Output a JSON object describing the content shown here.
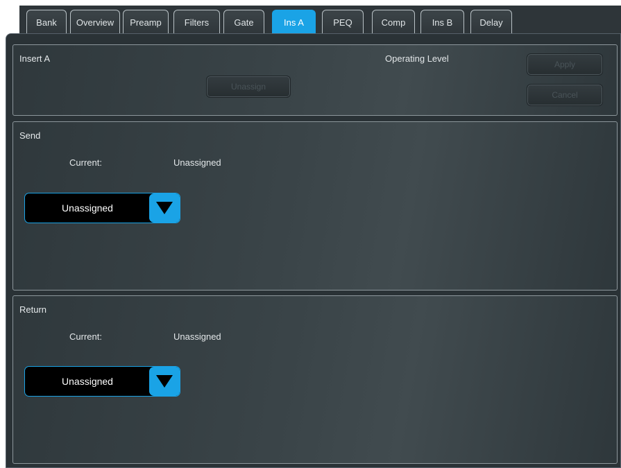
{
  "tabs": [
    {
      "label": "Bank"
    },
    {
      "label": "Overview"
    },
    {
      "label": "Preamp"
    },
    {
      "label": "Filters"
    },
    {
      "label": "Gate"
    },
    {
      "label": "Ins A"
    },
    {
      "label": "PEQ"
    },
    {
      "label": "Comp"
    },
    {
      "label": "Ins B"
    },
    {
      "label": "Delay"
    }
  ],
  "active_tab": "Ins A",
  "insert": {
    "title": "Insert A",
    "operating_level_label": "Operating Level",
    "unassign_label": "Unassign",
    "apply_label": "Apply",
    "cancel_label": "Cancel"
  },
  "send": {
    "title": "Send",
    "current_label": "Current:",
    "current_value": "Unassigned",
    "dropdown_value": "Unassigned"
  },
  "return": {
    "title": "Return",
    "current_label": "Current:",
    "current_value": "Unassigned",
    "dropdown_value": "Unassigned"
  },
  "colors": {
    "accent": "#1aa3e6",
    "panel_bg": "#3a4448"
  }
}
